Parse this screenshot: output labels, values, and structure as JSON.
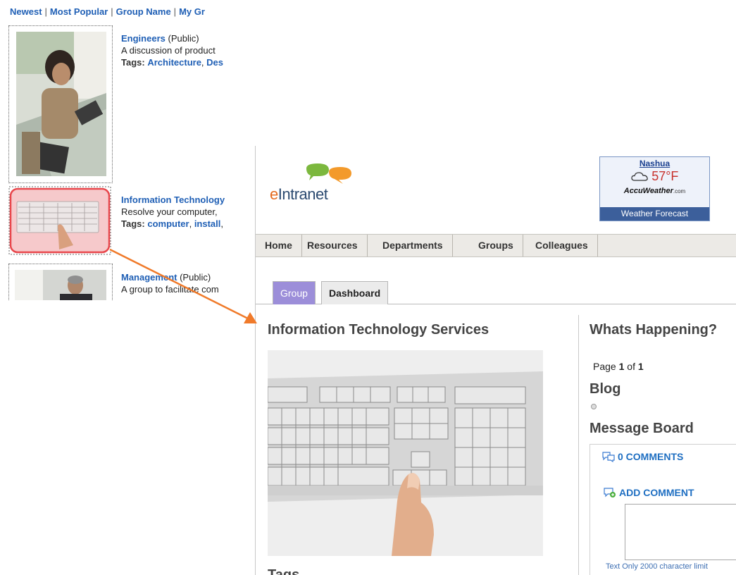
{
  "sort_bar": {
    "newest": "Newest",
    "most_popular": "Most Popular",
    "group_name": "Group Name",
    "my_groups": "My Gr",
    "separator": "|"
  },
  "groups": [
    {
      "title": "Engineers",
      "visibility": "(Public)",
      "description": "A discussion of product",
      "tags_label": "Tags:",
      "tags": [
        "Architecture",
        "Des"
      ]
    },
    {
      "title": "Information Technology",
      "visibility": "",
      "description": "Resolve your computer,",
      "tags_label": "Tags:",
      "tags": [
        "computer",
        "install"
      ]
    },
    {
      "title": "Management",
      "visibility": "(Public)",
      "description": "A group to facilitate com",
      "tags_label": "",
      "tags": []
    }
  ],
  "site": {
    "logo_e": "e",
    "logo_rest": "Intranet"
  },
  "weather": {
    "city": "Nashua",
    "temperature": "57°F",
    "brand": "AccuWeather",
    "brand_suffix": ".com",
    "forecast": "Weather Forecast"
  },
  "nav": [
    "Home",
    "Resources",
    "Departments",
    "Groups",
    "Colleagues"
  ],
  "tabs": {
    "group": "Group",
    "dashboard": "Dashboard"
  },
  "group_page": {
    "title": "Information Technology Services",
    "tags_heading": "Tags"
  },
  "sidebar": {
    "whats_happening": "Whats Happening?",
    "page_prefix": "Page ",
    "page_current": "1",
    "page_mid": " of ",
    "page_total": "1",
    "blog": "Blog",
    "message_board": "Message Board",
    "comments": "0 COMMENTS",
    "add_comment": "ADD COMMENT",
    "char_limit": "Text Only 2000 character limit"
  },
  "colors": {
    "link": "#1f5fb5",
    "active_tab": "#9c8ed9",
    "arrow": "#f07a2a",
    "highlight": "#e8474c"
  }
}
